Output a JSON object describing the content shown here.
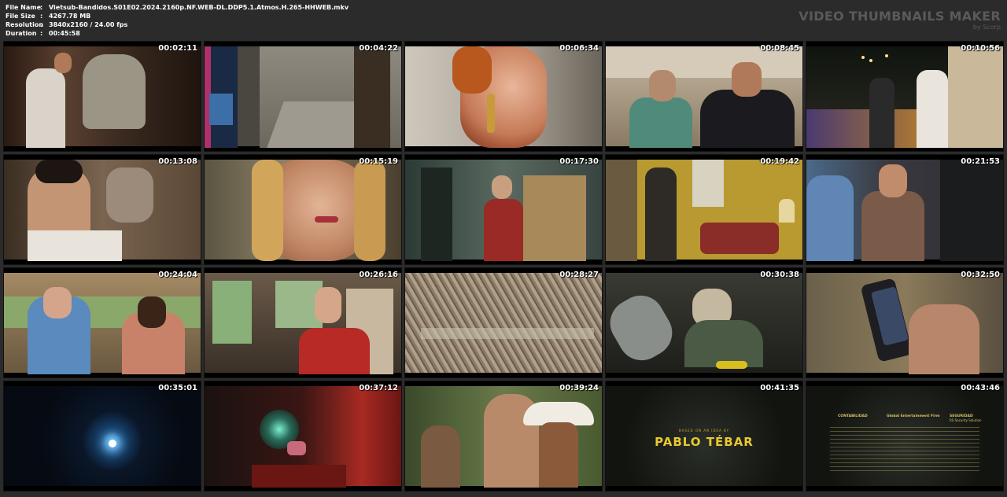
{
  "file_info": [
    {
      "key": "File Name",
      "value": "Vietsub-Bandidos.S01E02.2024.2160p.NF.WEB-DL.DDP5.1.Atmos.H.265-HHWEB.mkv"
    },
    {
      "key": "File Size",
      "value": "4267.78 MB"
    },
    {
      "key": "Resolution",
      "value": "3840x2160 / 24.00 fps"
    },
    {
      "key": "Duration",
      "value": "00:45:58"
    }
  ],
  "brand": {
    "title": "VIDEO THUMBNAILS MAKER",
    "subtitle": "by Scorp"
  },
  "thumbnails": [
    {
      "time": "00:02:11",
      "scene": "tuxedo-man-statue"
    },
    {
      "time": "00:04:22",
      "scene": "security-monitor-room"
    },
    {
      "time": "00:06:34",
      "scene": "woman-earring-closeup"
    },
    {
      "time": "00:08:45",
      "scene": "two-men-plaza"
    },
    {
      "time": "00:10:56",
      "scene": "night-street-couple"
    },
    {
      "time": "00:13:08",
      "scene": "men-hiding"
    },
    {
      "time": "00:15:19",
      "scene": "smiling-woman"
    },
    {
      "time": "00:17:30",
      "scene": "woman-shop-window"
    },
    {
      "time": "00:19:42",
      "scene": "yellow-room"
    },
    {
      "time": "00:21:53",
      "scene": "man-in-room"
    },
    {
      "time": "00:24:04",
      "scene": "van-interior-two"
    },
    {
      "time": "00:26:16",
      "scene": "woman-red-jacket-van"
    },
    {
      "time": "00:28:27",
      "scene": "dry-brush"
    },
    {
      "time": "00:30:38",
      "scene": "dog-cave"
    },
    {
      "time": "00:32:50",
      "scene": "phone-hand"
    },
    {
      "time": "00:35:01",
      "scene": "dark-blue-light"
    },
    {
      "time": "00:37:12",
      "scene": "red-cave-diver"
    },
    {
      "time": "00:39:24",
      "scene": "men-hats"
    },
    {
      "time": "00:41:35",
      "scene": "credit-title"
    },
    {
      "time": "00:43:46",
      "scene": "credit-columns"
    }
  ],
  "credits": {
    "above_name": "BASED ON AN IDEA BY",
    "name": "PABLO TÉBAR",
    "col1_head": "CONTABILIDAD",
    "col2_head": "Global Entertainment Firm",
    "col3_head": "SEGURIDAD",
    "col3_sub": "RS Security Solution"
  }
}
